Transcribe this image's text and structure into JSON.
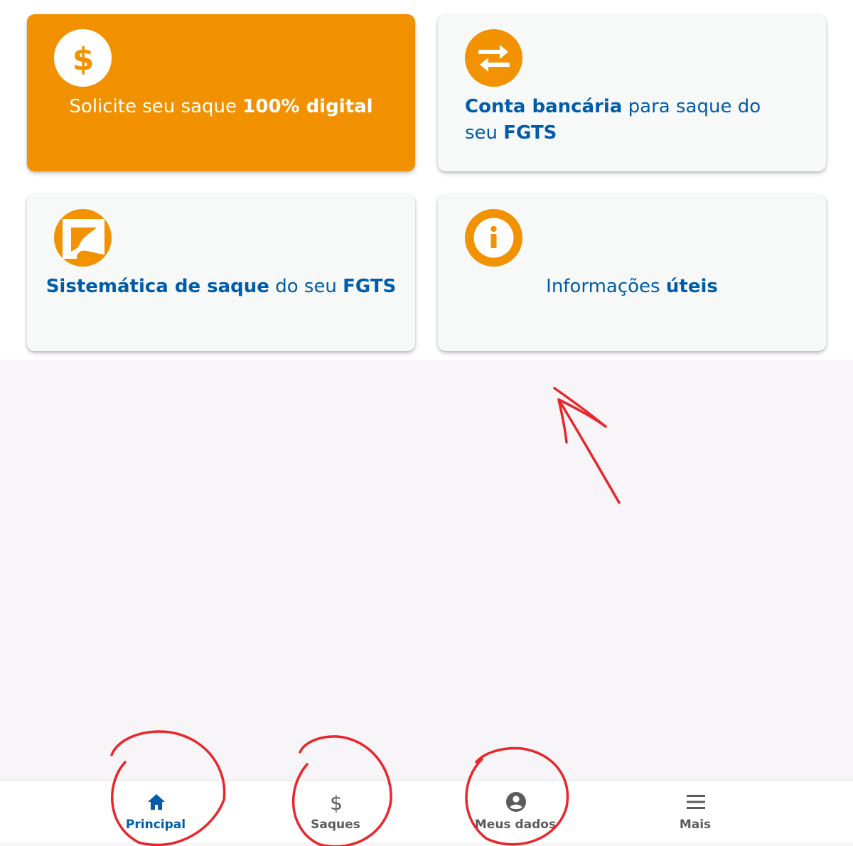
{
  "cards": [
    {
      "prefix": "Solicite seu saque ",
      "bold": "100% digital",
      "icon": "dollar-icon"
    },
    {
      "bold": "Conta bancária",
      "suffix": " para saque do seu ",
      "bold2": "FGTS",
      "icon": "transfer-arrows-icon"
    },
    {
      "bold": "Sistemática de saque",
      "suffix": " do seu ",
      "bold2": "FGTS",
      "icon": "fgts-logo-icon"
    },
    {
      "prefix": "Informações ",
      "bold": "úteis",
      "icon": "info-icon"
    }
  ],
  "nav": [
    {
      "label": "Principal",
      "icon": "home-icon",
      "active": true
    },
    {
      "label": "Saques",
      "icon": "dollar-icon",
      "active": false
    },
    {
      "label": "Meus dados",
      "icon": "account-circle-icon",
      "active": false
    },
    {
      "label": "Mais",
      "icon": "menu-icon",
      "active": false
    }
  ],
  "colors": {
    "accent_orange": "#f29100",
    "brand_blue": "#005ca9",
    "nav_inactive": "#5b5b5b",
    "annotation_red": "#e8262c",
    "background": "#f7f5f7"
  }
}
